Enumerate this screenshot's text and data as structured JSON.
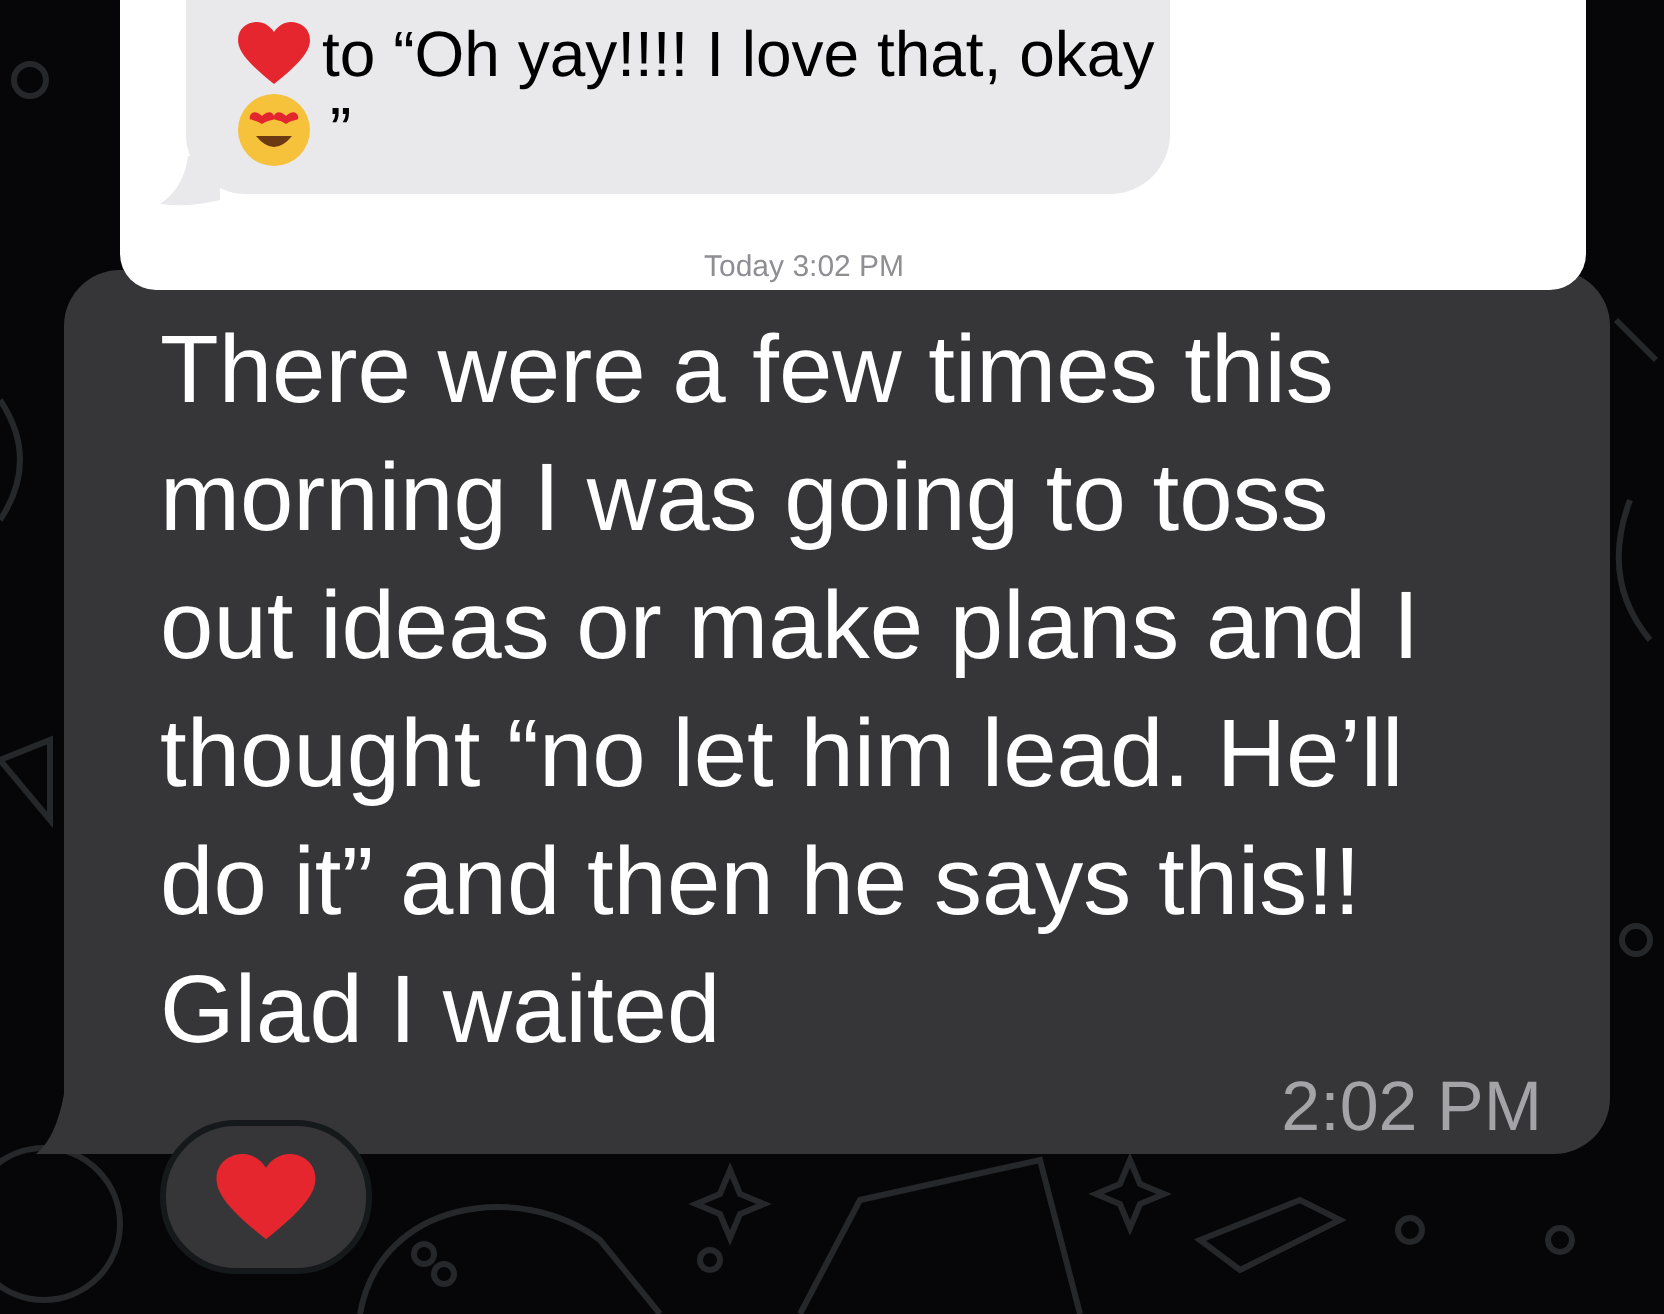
{
  "quoted_message": {
    "first_line": "to “Oh yay!!!! I love that, okay",
    "second_line": "”",
    "timestamp": "Today 3:02 PM"
  },
  "message": {
    "lines": [
      "There were a few times this",
      "morning I was going to toss",
      "out ideas or make plans and I",
      "thought “no let him lead. He’ll",
      "do it” and then he says this!!",
      "Glad I waited"
    ],
    "time": "2:02 PM"
  }
}
